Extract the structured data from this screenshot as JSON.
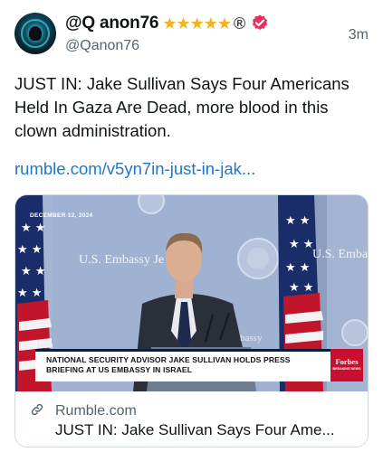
{
  "author": {
    "display_name": "@Q anon76",
    "stars": "★★★★★",
    "registered_mark": "®",
    "handle": "@Qanon76",
    "avatar_icon": "avatar-icon",
    "verified_icon": "verified-badge-icon",
    "verified_color": "#e8315b"
  },
  "tweet": {
    "time": "3m",
    "text": "JUST IN: Jake Sullivan Says Four Americans Held In Gaza Are Dead, more blood in this clown administration.",
    "link": "rumble.com/v5yn7in-just-in-jak...",
    "link_color": "#1d78c8"
  },
  "card": {
    "media": {
      "date_tag": "DECEMBER 12, 2024",
      "sign_left": "U.S. Embassy Je",
      "sign_right": "U.S. Embass",
      "sign_small": "bassy",
      "sign_lem": "lem",
      "caption": "NATIONAL SECURITY ADVISOR JAKE SULLIVAN HOLDS PRESS BRIEFING AT US EMBASSY IN ISRAEL",
      "logo_name": "Forbes",
      "logo_sub": "BREAKING NEWS",
      "logo_color": "#c8102e"
    },
    "domain": "Rumble.com",
    "title": "JUST IN: Jake Sullivan Says Four Ame...",
    "link_icon": "link-icon"
  }
}
